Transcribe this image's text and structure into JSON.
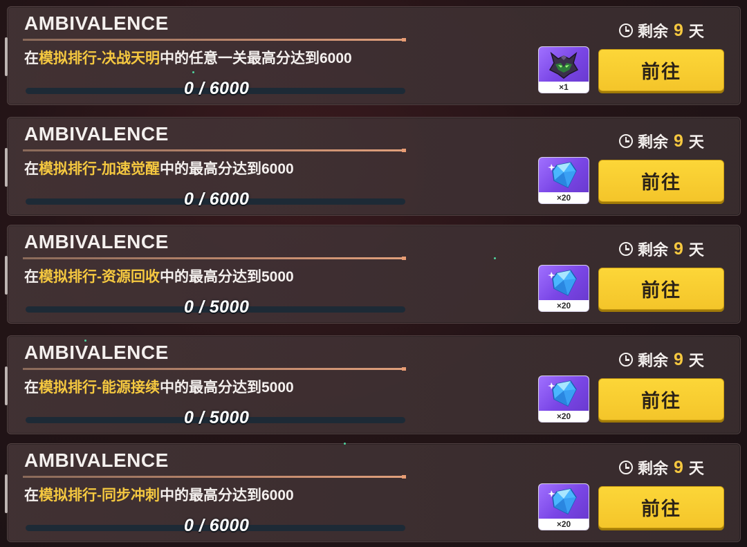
{
  "tasks": [
    {
      "title": "AMBIVALENCE",
      "desc_prefix": "在",
      "desc_highlight": "模拟排行-决战天明",
      "desc_suffix": "中的任意一关最高分达到6000",
      "progress_current": 0,
      "progress_target": 6000,
      "progress_text": "0 / 6000",
      "timer_label": "剩余",
      "timer_days": "9",
      "timer_unit": "天",
      "reward_icon": "mecha-helmet-icon",
      "reward_count": "×1",
      "button_label": "前往"
    },
    {
      "title": "AMBIVALENCE",
      "desc_prefix": "在",
      "desc_highlight": "模拟排行-加速觉醒",
      "desc_suffix": "中的最高分达到6000",
      "progress_current": 0,
      "progress_target": 6000,
      "progress_text": "0 / 6000",
      "timer_label": "剩余",
      "timer_days": "9",
      "timer_unit": "天",
      "reward_icon": "crystal-icon",
      "reward_count": "×20",
      "button_label": "前往"
    },
    {
      "title": "AMBIVALENCE",
      "desc_prefix": "在",
      "desc_highlight": "模拟排行-资源回收",
      "desc_suffix": "中的最高分达到5000",
      "progress_current": 0,
      "progress_target": 5000,
      "progress_text": "0 / 5000",
      "timer_label": "剩余",
      "timer_days": "9",
      "timer_unit": "天",
      "reward_icon": "crystal-icon",
      "reward_count": "×20",
      "button_label": "前往"
    },
    {
      "title": "AMBIVALENCE",
      "desc_prefix": "在",
      "desc_highlight": "模拟排行-能源接续",
      "desc_suffix": "中的最高分达到5000",
      "progress_current": 0,
      "progress_target": 5000,
      "progress_text": "0 / 5000",
      "timer_label": "剩余",
      "timer_days": "9",
      "timer_unit": "天",
      "reward_icon": "crystal-icon",
      "reward_count": "×20",
      "button_label": "前往"
    },
    {
      "title": "AMBIVALENCE",
      "desc_prefix": "在",
      "desc_highlight": "模拟排行-同步冲刺",
      "desc_suffix": "中的最高分达到6000",
      "progress_current": 0,
      "progress_target": 6000,
      "progress_text": "0 / 6000",
      "timer_label": "剩余",
      "timer_days": "9",
      "timer_unit": "天",
      "reward_icon": "crystal-icon",
      "reward_count": "×20",
      "button_label": "前往"
    }
  ],
  "colors": {
    "highlight": "#f5c840",
    "button": "#f8cf32",
    "reward_bg": "#8a56f0"
  }
}
